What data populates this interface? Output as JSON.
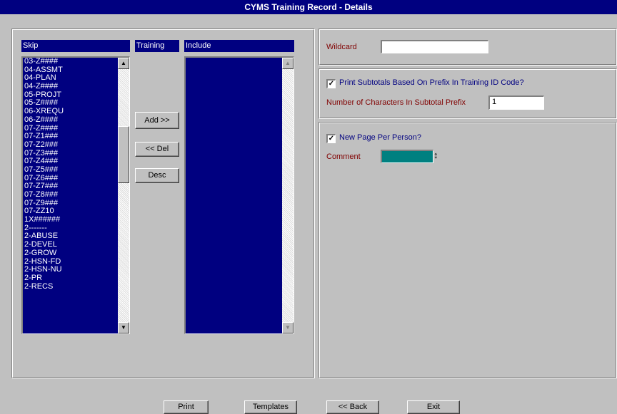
{
  "window": {
    "title": "CYMS Training Record - Details"
  },
  "lists": {
    "skip_header": "Skip",
    "training_header": "Training",
    "include_header": "Include",
    "skip_items": [
      "03-Z####",
      "04-ASSMT",
      "04-PLAN",
      "04-Z####",
      "05-PROJT",
      "05-Z####",
      "06-XREQU",
      "06-Z####",
      "07-Z####",
      "07-Z1###",
      "07-Z2###",
      "07-Z3###",
      "07-Z4###",
      "07-Z5###",
      "07-Z6###",
      "07-Z7###",
      "07-Z8###",
      "07-Z9###",
      "07-ZZ10",
      "1X######",
      "2-------",
      "2-ABUSE",
      "2-DEVEL",
      "2-GROW",
      "2-HSN-FD",
      "2-HSN-NU",
      "2-PR",
      "2-RECS"
    ],
    "include_items": []
  },
  "buttons": {
    "add": "Add >>",
    "del": "<< Del",
    "desc": "Desc",
    "print": "Print",
    "templates": "Templates",
    "back": "<< Back",
    "exit": "Exit"
  },
  "wildcard": {
    "label": "Wildcard",
    "value": ""
  },
  "subtotals": {
    "checkbox_label": "Print Subtotals Based On Prefix In Training ID Code?",
    "checked": true,
    "chars_label": "Number of Characters In Subtotal Prefix",
    "chars_value": "1"
  },
  "person": {
    "checkbox_label": "New Page Per Person?",
    "checked": true,
    "comment_label": "Comment",
    "comment_color": "#008080",
    "updown_glyph": "↕"
  },
  "scroll_glyphs": {
    "up": "▲",
    "down": "▼"
  },
  "check_glyph": "✓",
  "colors": {
    "title_bg": "#000080",
    "list_bg": "#000080",
    "label_red": "#800000"
  }
}
